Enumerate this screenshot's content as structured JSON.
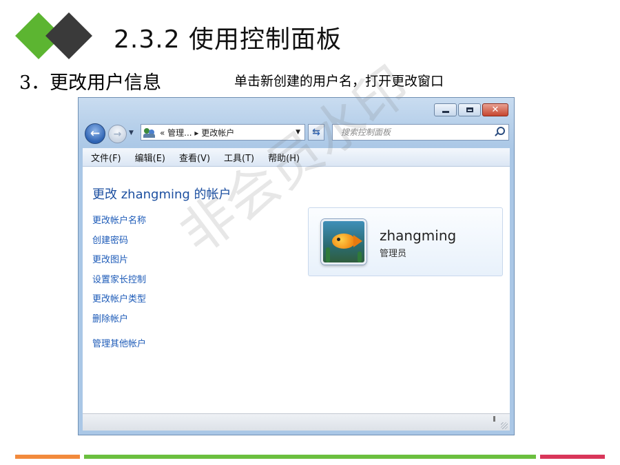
{
  "slide": {
    "title": "2.3.2  使用控制面板",
    "section": "3．更改用户信息",
    "note": "单击新创建的用户名，打开更改窗口",
    "logo_colors": {
      "green": "#5cb531",
      "dark": "#3a3a3a"
    },
    "stripe_colors": {
      "orange": "#f28a3c",
      "green": "#6bbf3f",
      "red": "#d9365a"
    }
  },
  "window": {
    "buttons": {
      "minimize": "",
      "maximize": "",
      "close": "✕"
    },
    "address": {
      "path": "«  管理...  ▸  更改帐户",
      "icon": "user-accounts-icon"
    },
    "search": {
      "placeholder": "搜索控制面板"
    },
    "menu": [
      "文件(F)",
      "编辑(E)",
      "查看(V)",
      "工具(T)",
      "帮助(H)"
    ],
    "heading": "更改 zhangming 的帐户",
    "tasks": [
      "更改帐户名称",
      "创建密码",
      "更改图片",
      "设置家长控制",
      "更改帐户类型",
      "删除帐户"
    ],
    "other_task": "管理其他帐户",
    "account": {
      "name": "zhangming",
      "role": "管理员"
    },
    "watermark": "非会员水印"
  }
}
